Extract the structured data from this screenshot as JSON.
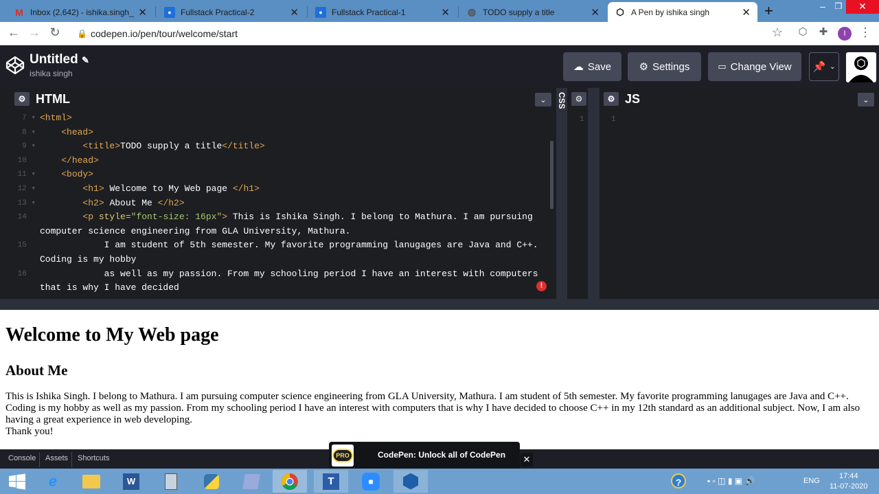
{
  "browser": {
    "tabs": [
      {
        "title": "Inbox (2,642) - ishika.singh_cs18",
        "icon": "gmail-icon",
        "active": false
      },
      {
        "title": "Fullstack Practical-2",
        "icon": "classroom-icon",
        "active": false
      },
      {
        "title": "Fullstack Practical-1",
        "icon": "classroom-icon",
        "active": false
      },
      {
        "title": "TODO supply a title",
        "icon": "globe-icon",
        "active": false
      },
      {
        "title": "A Pen by ishika singh",
        "icon": "codepen-icon",
        "active": true
      }
    ],
    "url": "codepen.io/pen/tour/welcome/start",
    "profile_initial": "I"
  },
  "codepen": {
    "title": "Untitled",
    "author": "ishika singh",
    "save_label": "Save",
    "settings_label": "Settings",
    "change_view_label": "Change View"
  },
  "editors": {
    "html_title": "HTML",
    "css_title": "CSS",
    "js_title": "JS",
    "css_line": "1",
    "js_line": "1",
    "html_lines": [
      {
        "n": "7",
        "fold": true,
        "indent": "",
        "html": "<span class=\"tag\">&lt;html&gt;</span>"
      },
      {
        "n": "8",
        "fold": true,
        "indent": "    ",
        "html": "<span class=\"tag\">&lt;head&gt;</span>"
      },
      {
        "n": "9",
        "fold": true,
        "indent": "        ",
        "html": "<span class=\"tag\">&lt;title&gt;</span>TODO supply a title<span class=\"tag\">&lt;/title&gt;</span>"
      },
      {
        "n": "10",
        "fold": false,
        "indent": "    ",
        "html": "<span class=\"tag\">&lt;/head&gt;</span>"
      },
      {
        "n": "11",
        "fold": true,
        "indent": "    ",
        "html": "<span class=\"tag\">&lt;body&gt;</span>"
      },
      {
        "n": "12",
        "fold": true,
        "indent": "        ",
        "html": "<span class=\"tag\">&lt;h1&gt;</span> Welcome to My Web page <span class=\"tag\">&lt;/h1&gt;</span>"
      },
      {
        "n": "13",
        "fold": true,
        "indent": "        ",
        "html": "<span class=\"tag\">&lt;h2&gt;</span> About Me <span class=\"tag\">&lt;/h2&gt;</span>"
      },
      {
        "n": "14",
        "fold": false,
        "indent": "        ",
        "html": "<span class=\"tag\">&lt;p </span><span class=\"attr\">style=</span><span class=\"str\">\"font-size: 16px\"</span><span class=\"tag\">&gt;</span> This is Ishika Singh. I belong to Mathura. I am pursuing"
      },
      {
        "n": "",
        "fold": false,
        "indent": "",
        "html": "computer science engineering from GLA University, Mathura."
      },
      {
        "n": "15",
        "fold": false,
        "indent": "            ",
        "html": "I am student of 5th semester. My favorite programming lanugages are Java and C++."
      },
      {
        "n": "",
        "fold": false,
        "indent": "",
        "html": "Coding is my hobby"
      },
      {
        "n": "16",
        "fold": false,
        "indent": "            ",
        "html": "as well as my passion. From my schooling period I have an interest with computers"
      },
      {
        "n": "",
        "fold": false,
        "indent": "",
        "html": "that is why I have decided"
      }
    ]
  },
  "preview": {
    "h1": "Welcome to My Web page",
    "h2": "About Me",
    "p": "This is Ishika Singh. I belong to Mathura. I am pursuing computer science engineering from GLA University, Mathura. I am student of 5th semester. My favorite programming lanugages are Java and C++. Coding is my hobby as well as my passion. From my schooling period I have an interest with computers that is why I have decided to choose C++ in my 12th standard as an additional subject. Now, I am also having a great experience in web developing.",
    "p2": "Thank you!"
  },
  "bottom_bar": {
    "console": "Console",
    "assets": "Assets",
    "shortcuts": "Shortcuts",
    "promo_badge": "PRO",
    "promo_text": "CodePen: Unlock all of CodePen"
  },
  "taskbar": {
    "lang": "ENG",
    "time": "17:44",
    "date": "11-07-2020"
  },
  "colors": {
    "tabbar": "#5a8fc4",
    "codepen_bg": "#1e1f26",
    "button_bg": "#444857",
    "tag": "#e1a94f",
    "string": "#a6c86c",
    "taskbar": "#6ea0cf"
  }
}
